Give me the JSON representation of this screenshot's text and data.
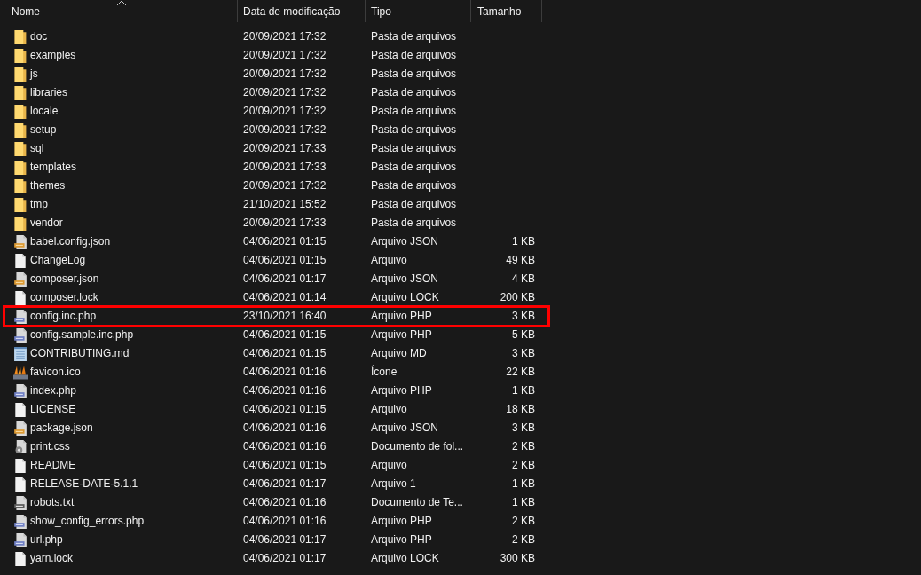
{
  "columns": [
    {
      "label": "Nome",
      "sorted": true
    },
    {
      "label": "Data de modificação",
      "sorted": false
    },
    {
      "label": "Tipo",
      "sorted": false
    },
    {
      "label": "Tamanho",
      "sorted": false
    }
  ],
  "rows": [
    {
      "kind": "folder",
      "name": "doc",
      "modified": "20/09/2021 17:32",
      "type": "Pasta de arquivos",
      "highlighted": false
    },
    {
      "kind": "folder",
      "name": "examples",
      "modified": "20/09/2021 17:32",
      "type": "Pasta de arquivos",
      "highlighted": false
    },
    {
      "kind": "folder",
      "name": "js",
      "modified": "20/09/2021 17:32",
      "type": "Pasta de arquivos",
      "highlighted": false
    },
    {
      "kind": "folder",
      "name": "libraries",
      "modified": "20/09/2021 17:32",
      "type": "Pasta de arquivos",
      "highlighted": false
    },
    {
      "kind": "folder",
      "name": "locale",
      "modified": "20/09/2021 17:32",
      "type": "Pasta de arquivos",
      "highlighted": false
    },
    {
      "kind": "folder",
      "name": "setup",
      "modified": "20/09/2021 17:32",
      "type": "Pasta de arquivos",
      "highlighted": false
    },
    {
      "kind": "folder",
      "name": "sql",
      "modified": "20/09/2021 17:33",
      "type": "Pasta de arquivos",
      "highlighted": false
    },
    {
      "kind": "folder",
      "name": "templates",
      "modified": "20/09/2021 17:33",
      "type": "Pasta de arquivos",
      "highlighted": false
    },
    {
      "kind": "folder",
      "name": "themes",
      "modified": "20/09/2021 17:32",
      "type": "Pasta de arquivos",
      "highlighted": false
    },
    {
      "kind": "folder",
      "name": "tmp",
      "modified": "21/10/2021 15:52",
      "type": "Pasta de arquivos",
      "highlighted": false
    },
    {
      "kind": "folder",
      "name": "vendor",
      "modified": "20/09/2021 17:33",
      "type": "Pasta de arquivos",
      "highlighted": false
    },
    {
      "kind": "json",
      "name": "babel.config.json",
      "modified": "04/06/2021 01:15",
      "type": "Arquivo JSON",
      "size": "1 KB",
      "highlighted": false
    },
    {
      "kind": "file",
      "name": "ChangeLog",
      "modified": "04/06/2021 01:15",
      "type": "Arquivo",
      "size": "49 KB",
      "highlighted": false
    },
    {
      "kind": "json",
      "name": "composer.json",
      "modified": "04/06/2021 01:17",
      "type": "Arquivo JSON",
      "size": "4 KB",
      "highlighted": false
    },
    {
      "kind": "file",
      "name": "composer.lock",
      "modified": "04/06/2021 01:14",
      "type": "Arquivo LOCK",
      "size": "200 KB",
      "highlighted": false
    },
    {
      "kind": "php",
      "name": "config.inc.php",
      "modified": "23/10/2021 16:40",
      "type": "Arquivo PHP",
      "size": "3 KB",
      "highlighted": true
    },
    {
      "kind": "php",
      "name": "config.sample.inc.php",
      "modified": "04/06/2021 01:15",
      "type": "Arquivo PHP",
      "size": "5 KB",
      "highlighted": false
    },
    {
      "kind": "markdown",
      "name": "CONTRIBUTING.md",
      "modified": "04/06/2021 01:15",
      "type": "Arquivo MD",
      "size": "3 KB",
      "highlighted": false
    },
    {
      "kind": "icon",
      "name": "favicon.ico",
      "modified": "04/06/2021 01:16",
      "type": "Ícone",
      "size": "22 KB",
      "highlighted": false
    },
    {
      "kind": "php",
      "name": "index.php",
      "modified": "04/06/2021 01:16",
      "type": "Arquivo PHP",
      "size": "1 KB",
      "highlighted": false
    },
    {
      "kind": "file",
      "name": "LICENSE",
      "modified": "04/06/2021 01:15",
      "type": "Arquivo",
      "size": "18 KB",
      "highlighted": false
    },
    {
      "kind": "json",
      "name": "package.json",
      "modified": "04/06/2021 01:16",
      "type": "Arquivo JSON",
      "size": "3 KB",
      "highlighted": false
    },
    {
      "kind": "css",
      "name": "print.css",
      "modified": "04/06/2021 01:16",
      "type": "Documento de fol...",
      "size": "2 KB",
      "highlighted": false
    },
    {
      "kind": "file",
      "name": "README",
      "modified": "04/06/2021 01:15",
      "type": "Arquivo",
      "size": "2 KB",
      "highlighted": false
    },
    {
      "kind": "file",
      "name": "RELEASE-DATE-5.1.1",
      "modified": "04/06/2021 01:17",
      "type": "Arquivo 1",
      "size": "1 KB",
      "highlighted": false
    },
    {
      "kind": "text",
      "name": "robots.txt",
      "modified": "04/06/2021 01:16",
      "type": "Documento de Te...",
      "size": "1 KB",
      "highlighted": false
    },
    {
      "kind": "php",
      "name": "show_config_errors.php",
      "modified": "04/06/2021 01:16",
      "type": "Arquivo PHP",
      "size": "2 KB",
      "highlighted": false
    },
    {
      "kind": "php",
      "name": "url.php",
      "modified": "04/06/2021 01:17",
      "type": "Arquivo PHP",
      "size": "2 KB",
      "highlighted": false
    },
    {
      "kind": "file",
      "name": "yarn.lock",
      "modified": "04/06/2021 01:17",
      "type": "Arquivo LOCK",
      "size": "300 KB",
      "highlighted": false
    }
  ]
}
